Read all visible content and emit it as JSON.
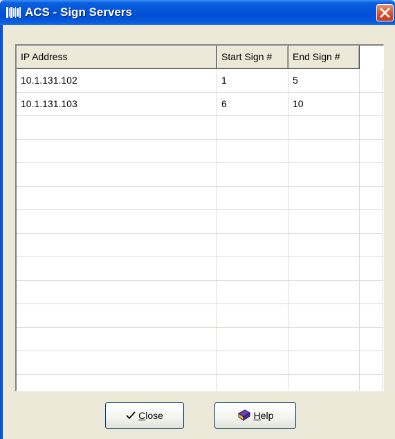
{
  "window": {
    "title": "ACS - Sign Servers",
    "icon": "barcode-app-icon",
    "close_icon": "close-icon"
  },
  "table": {
    "columns": [
      "IP Address",
      "Start Sign #",
      "End Sign #"
    ],
    "rows": [
      [
        "10.1.131.102",
        "1",
        "5"
      ],
      [
        "10.1.131.103",
        "6",
        "10"
      ],
      [
        "",
        "",
        ""
      ],
      [
        "",
        "",
        ""
      ],
      [
        "",
        "",
        ""
      ],
      [
        "",
        "",
        ""
      ],
      [
        "",
        "",
        ""
      ],
      [
        "",
        "",
        ""
      ],
      [
        "",
        "",
        ""
      ],
      [
        "",
        "",
        ""
      ],
      [
        "",
        "",
        ""
      ],
      [
        "",
        "",
        ""
      ],
      [
        "",
        "",
        ""
      ],
      [
        "",
        "",
        ""
      ]
    ]
  },
  "buttons": {
    "close": {
      "mnemonic": "C",
      "rest": "lose",
      "icon": "checkmark-icon"
    },
    "help": {
      "mnemonic": "H",
      "rest": "elp",
      "icon": "help-book-icon"
    }
  },
  "colors": {
    "titlebar": "#0454d8",
    "window_bg": "#ece9d8",
    "close_button": "#d8512a"
  }
}
